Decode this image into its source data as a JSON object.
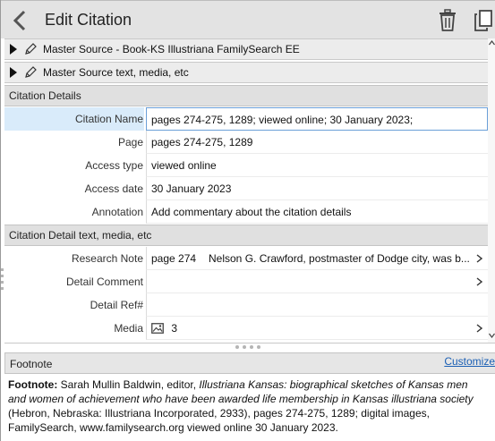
{
  "header": {
    "title": "Edit Citation"
  },
  "sources": [
    {
      "label": "Master Source - Book-KS Illustriana FamilySearch EE"
    },
    {
      "label": "Master Source text, media, etc"
    }
  ],
  "citation_details": {
    "heading": "Citation Details",
    "fields": {
      "citation_name": {
        "label": "Citation Name",
        "value": "pages 274-275, 1289; viewed online; 30 January 2023;"
      },
      "page": {
        "label": "Page",
        "value": "pages 274-275, 1289"
      },
      "access_type": {
        "label": "Access type",
        "value": "viewed online"
      },
      "access_date": {
        "label": "Access date",
        "value": "30 January 2023"
      },
      "annotation": {
        "label": "Annotation",
        "placeholder": "Add commentary about the citation details"
      }
    }
  },
  "detail_text": {
    "heading": "Citation Detail text, media, etc",
    "research_note": {
      "label": "Research Note",
      "page": "page 274",
      "text": "Nelson G. Crawford, postmaster of Dodge city, was b..."
    },
    "detail_comment": {
      "label": "Detail Comment"
    },
    "detail_ref": {
      "label": "Detail Ref#"
    },
    "media": {
      "label": "Media",
      "count": "3"
    }
  },
  "footnote": {
    "heading": "Footnote",
    "customize_label": "Customize",
    "prefix": "Footnote:",
    "part1": " Sarah Mullin Baldwin, editor, ",
    "italic": "Illustriana Kansas: biographical sketches of Kansas men and women of achievement who have been awarded life membership in Kansas illustriana society",
    "part2": " (Hebron, Nebraska: Illustriana Incorporated, 2933), pages 274-275, 1289; digital images, FamilySearch, www.familysearch.org viewed online 30 January 2023."
  }
}
